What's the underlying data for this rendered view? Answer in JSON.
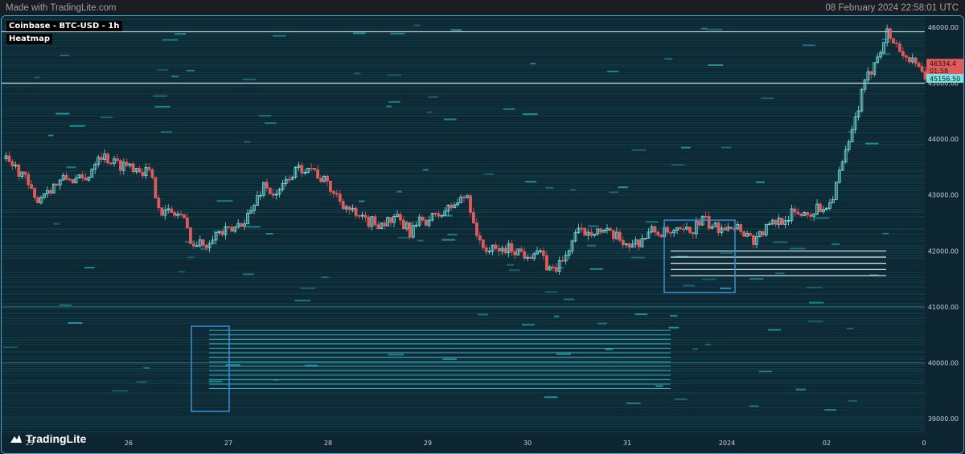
{
  "header": {
    "made_with": "Made with TradingLite.com",
    "timestamp": "08 February 2024 22:58:01 UTC"
  },
  "chart_info": {
    "symbol_title": "Coinbase - BTC-USD - 1h",
    "layer": "Heatmap"
  },
  "brand": {
    "name": "TradingLite"
  },
  "colors": {
    "background": "#0c2530",
    "up": "#7fe0e0",
    "down": "#e05a5a",
    "liquidity": "#2aa6b8",
    "highlight": "#3a8fd8"
  },
  "chart_data": {
    "type": "candlestick",
    "ylim": [
      38700,
      46200
    ],
    "y_ticks": [
      "46000.00",
      "45000.00",
      "44000.00",
      "43000.00",
      "42000.00",
      "41000.00",
      "40000.00",
      "39000.00"
    ],
    "y_tick_values": [
      46000,
      45000,
      44000,
      43000,
      42000,
      41000,
      40000,
      39000
    ],
    "x_ticks": [
      "25",
      "26",
      "27",
      "28",
      "29",
      "30",
      "31",
      "2024",
      "02",
      "0"
    ],
    "price_tags": [
      {
        "label": "46334.4",
        "value": 45350,
        "color": "#e05a5a"
      },
      {
        "label": "01:58",
        "value": 45220,
        "color": "#e05a5a"
      },
      {
        "label": "45156.50",
        "value": 45080,
        "color": "#7fe0e0"
      }
    ],
    "horizontal_levels": [
      45920,
      45000,
      41000,
      40000
    ],
    "bid_wall_levels": [
      42000,
      41890,
      41780,
      41670,
      41560
    ],
    "ask_wall_levels": [
      40580,
      40500,
      40420,
      40340,
      40260,
      40180,
      40100,
      40020,
      39940,
      39860,
      39780,
      39700,
      39620,
      39540
    ],
    "price_path": [
      [
        0,
        43650
      ],
      [
        6,
        43400
      ],
      [
        10,
        42900
      ],
      [
        14,
        43100
      ],
      [
        20,
        43300
      ],
      [
        26,
        43250
      ],
      [
        30,
        43750
      ],
      [
        36,
        43550
      ],
      [
        40,
        43550
      ],
      [
        46,
        43400
      ],
      [
        50,
        42700
      ],
      [
        56,
        42650
      ],
      [
        60,
        42100
      ],
      [
        64,
        42150
      ],
      [
        66,
        42300
      ],
      [
        72,
        42350
      ],
      [
        78,
        42700
      ],
      [
        82,
        43200
      ],
      [
        86,
        42950
      ],
      [
        90,
        43350
      ],
      [
        96,
        43550
      ],
      [
        100,
        43300
      ],
      [
        104,
        43050
      ],
      [
        108,
        42800
      ],
      [
        112,
        42550
      ],
      [
        118,
        42500
      ],
      [
        124,
        42550
      ],
      [
        128,
        42350
      ],
      [
        132,
        42550
      ],
      [
        136,
        42600
      ],
      [
        140,
        42750
      ],
      [
        146,
        43000
      ],
      [
        150,
        42100
      ],
      [
        154,
        42000
      ],
      [
        160,
        42050
      ],
      [
        164,
        41950
      ],
      [
        168,
        42000
      ],
      [
        172,
        41650
      ],
      [
        176,
        41800
      ],
      [
        180,
        42300
      ],
      [
        186,
        42400
      ],
      [
        192,
        42250
      ],
      [
        198,
        42100
      ],
      [
        204,
        42350
      ],
      [
        210,
        42300
      ],
      [
        216,
        42350
      ],
      [
        220,
        42550
      ],
      [
        224,
        42400
      ],
      [
        228,
        42500
      ],
      [
        232,
        42400
      ],
      [
        236,
        42200
      ],
      [
        240,
        42400
      ],
      [
        244,
        42550
      ],
      [
        248,
        42650
      ],
      [
        254,
        42700
      ],
      [
        260,
        42850
      ],
      [
        266,
        43900
      ],
      [
        270,
        44800
      ],
      [
        274,
        45400
      ],
      [
        278,
        45900
      ],
      [
        282,
        45600
      ],
      [
        286,
        45350
      ],
      [
        290,
        45100
      ]
    ]
  }
}
